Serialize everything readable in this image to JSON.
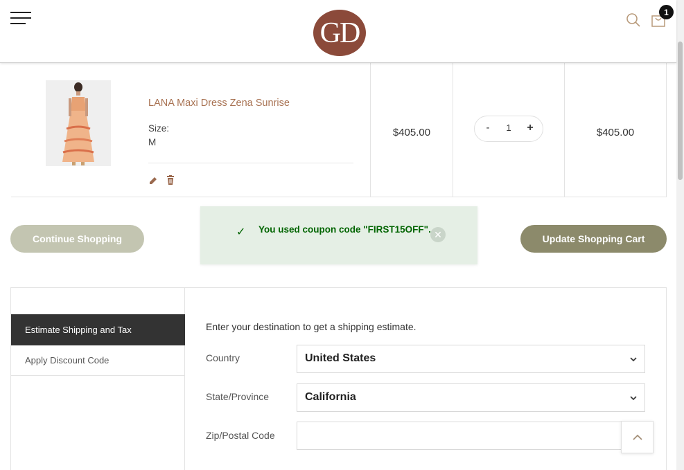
{
  "header": {
    "logo_text": "GD",
    "cart_count": "1",
    "icons": [
      "menu-icon",
      "search-icon",
      "cart-icon"
    ],
    "colors": {
      "logo_bg": "#8b4a3a",
      "badge_bg": "#111111"
    }
  },
  "cart": {
    "item": {
      "name": "LANA Maxi Dress Zena Sunrise",
      "size_label": "Size:",
      "size_value": "M",
      "price": "$405.00",
      "qty_minus": "-",
      "qty_value": "1",
      "qty_plus": "+",
      "subtotal": "$405.00"
    }
  },
  "actions": {
    "continue_label": "Continue Shopping",
    "update_label": "Update Shopping Cart"
  },
  "notice": {
    "check": "✓",
    "message": "You used coupon code \"FIRST15OFF\".",
    "close": "✕"
  },
  "summary": {
    "tabs": [
      {
        "label": "Estimate Shipping and Tax",
        "active": true
      },
      {
        "label": "Apply Discount Code",
        "active": false
      }
    ],
    "intro": "Enter your destination to get a shipping estimate.",
    "fields": {
      "country_label": "Country",
      "country_value": "United States",
      "state_label": "State/Province",
      "state_value": "California",
      "zip_label": "Zip/Postal Code",
      "zip_value": ""
    }
  }
}
